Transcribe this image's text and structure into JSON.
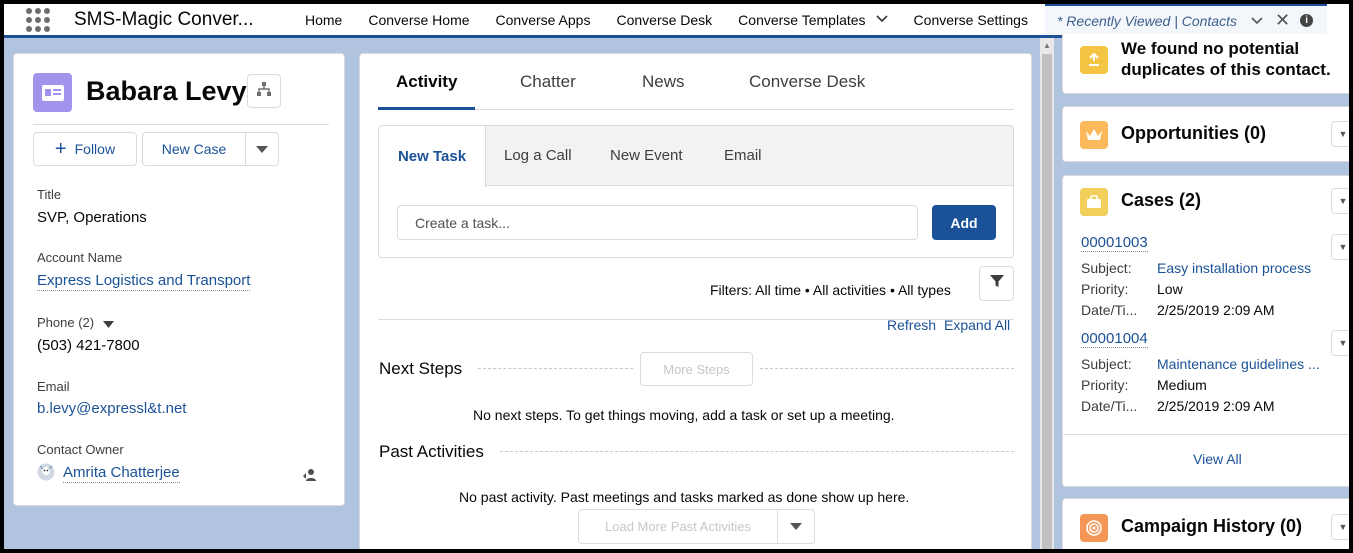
{
  "topnav": {
    "app_name": "SMS-Magic Conver...",
    "items": [
      "Home",
      "Converse Home",
      "Converse Apps",
      "Converse Desk",
      "Converse Templates",
      "Converse Settings"
    ],
    "active_tab": "* Recently Viewed | Contacts"
  },
  "contact": {
    "name": "Babara Levy",
    "follow_label": "Follow",
    "new_case_label": "New Case",
    "fields": {
      "title_label": "Title",
      "title_value": "SVP, Operations",
      "account_label": "Account Name",
      "account_value": "Express Logistics and Transport",
      "phone_label": "Phone (2)",
      "phone_value": "(503) 421-7800",
      "email_label": "Email",
      "email_value": "b.levy@expressl&t.net",
      "owner_label": "Contact Owner",
      "owner_value": "Amrita Chatterjee"
    }
  },
  "activity": {
    "tabs": [
      "Activity",
      "Chatter",
      "News",
      "Converse Desk"
    ],
    "composer_tabs": [
      "New Task",
      "Log a Call",
      "New Event",
      "Email"
    ],
    "task_placeholder": "Create a task...",
    "add_label": "Add",
    "filters_text": "Filters: All time • All activities • All types",
    "refresh_label": "Refresh",
    "expand_all_label": "Expand All",
    "next_steps_title": "Next Steps",
    "more_steps_label": "More Steps",
    "next_steps_note": "No next steps. To get things moving, add a task or set up a meeting.",
    "past_activities_title": "Past Activities",
    "past_note": "No past activity. Past meetings and tasks marked as done show up here.",
    "load_more_label": "Load More Past Activities"
  },
  "right": {
    "duplicates_text_line1": "We found no potential",
    "duplicates_text_line2": "duplicates of this contact.",
    "opportunities_title": "Opportunities (0)",
    "cases_title": "Cases (2)",
    "cases": [
      {
        "number": "00001003",
        "subject_label": "Subject:",
        "subject": "Easy installation process",
        "priority_label": "Priority:",
        "priority": "Low",
        "date_label": "Date/Ti...",
        "date": "2/25/2019 2:09 AM"
      },
      {
        "number": "00001004",
        "subject_label": "Subject:",
        "subject": "Maintenance guidelines ...",
        "priority_label": "Priority:",
        "priority": "Medium",
        "date_label": "Date/Ti...",
        "date": "2/25/2019 2:09 AM"
      }
    ],
    "view_all_label": "View All",
    "campaign_title": "Campaign History (0)"
  },
  "colors": {
    "brand": "#1b5297",
    "contact_icon": "#a094ed",
    "duplicates_icon": "#f4c542",
    "opportunity_icon": "#fcb95b",
    "cases_icon": "#f2cf5b",
    "campaign_icon": "#f49756"
  }
}
